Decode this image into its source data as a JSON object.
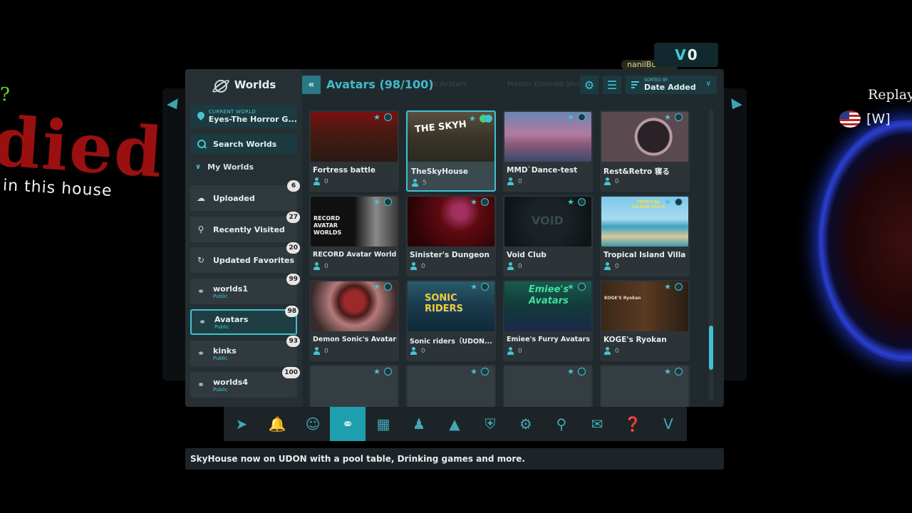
{
  "background": {
    "graffiti_word": "died",
    "graffiti_sub": "in this house",
    "right_nameplate": "Replay",
    "right_tag": "[W]"
  },
  "balance": {
    "currency_icon": "V",
    "amount": "0"
  },
  "nameplate_top": "nanilBu",
  "sidebar": {
    "header": "Worlds",
    "current_world_label": "CURRENT WORLD",
    "current_world_name": "Eyes-The Horror G...",
    "search_label": "Search Worlds",
    "my_worlds_label": "My Worlds",
    "items": [
      {
        "label": "Uploaded",
        "sub": "",
        "count": "6",
        "icon": "upload-icon"
      },
      {
        "label": "Recently Visited",
        "sub": "",
        "count": "27",
        "icon": "location-icon"
      },
      {
        "label": "Updated Favorites",
        "sub": "",
        "count": "20",
        "icon": "history-icon"
      },
      {
        "label": "worlds1",
        "sub": "Public",
        "count": "99",
        "icon": "planet-icon"
      },
      {
        "label": "Avatars",
        "sub": "Public",
        "count": "98",
        "icon": "planet-icon"
      },
      {
        "label": "kinks",
        "sub": "Public",
        "count": "93",
        "icon": "planet-icon"
      },
      {
        "label": "worlds4",
        "sub": "Public",
        "count": "100",
        "icon": "planet-icon"
      }
    ]
  },
  "content": {
    "title": "Avatars (98/100)",
    "ghost_tabs": [
      "'s Avatars",
      "Master Emerald Shri"
    ],
    "sort_label": "SORTED BY",
    "sort_value": "Date Added",
    "cards": [
      {
        "name": "Fortress battle",
        "count": "0"
      },
      {
        "name": "TheSkyHouse",
        "count": "5",
        "thumb_text": "THE SKYH"
      },
      {
        "name": "MMD`Dance-test",
        "count": "0"
      },
      {
        "name": "Rest&Retro 寝る",
        "count": "0"
      },
      {
        "name": "RECORD Avatar World...",
        "count": "0",
        "thumb_text": "RECORD AVATAR WORLDS"
      },
      {
        "name": "Sinister's Dungeon",
        "count": "0"
      },
      {
        "name": "Void Club",
        "count": "0",
        "thumb_text": "VOID"
      },
      {
        "name": "Tropical Island Villa",
        "count": "0",
        "thumb_text": "TROPICAL ISLAND VILLA"
      },
      {
        "name": "Demon Sonic's Avatars",
        "count": "0"
      },
      {
        "name": "Sonic riders（UDON...",
        "count": "0",
        "thumb_text": "SONIC RIDERS"
      },
      {
        "name": "Emiee's Furry Avatars",
        "count": "0",
        "thumb_text": "Emiee's Avatars"
      },
      {
        "name": "KOGE's Ryokan",
        "count": "0",
        "thumb_text": "KOGE'S Ryokan"
      },
      {
        "name": "",
        "count": ""
      },
      {
        "name": "",
        "count": ""
      },
      {
        "name": "",
        "count": ""
      },
      {
        "name": "",
        "count": ""
      }
    ]
  },
  "nav": [
    "launch-icon",
    "notification-icon",
    "profile-icon",
    "worlds-icon",
    "avatars-icon",
    "social-icon",
    "groups-icon",
    "safety-icon",
    "settings-icon",
    "search-icon",
    "chat-icon",
    "help-icon",
    "vrchat-plus-icon"
  ],
  "status_message": "SkyHouse now on UDON with a pool table, Drinking games and more.",
  "colors": {
    "accent": "#3fc2d1",
    "panel": "#202a2e",
    "sidebar": "#262f33"
  }
}
